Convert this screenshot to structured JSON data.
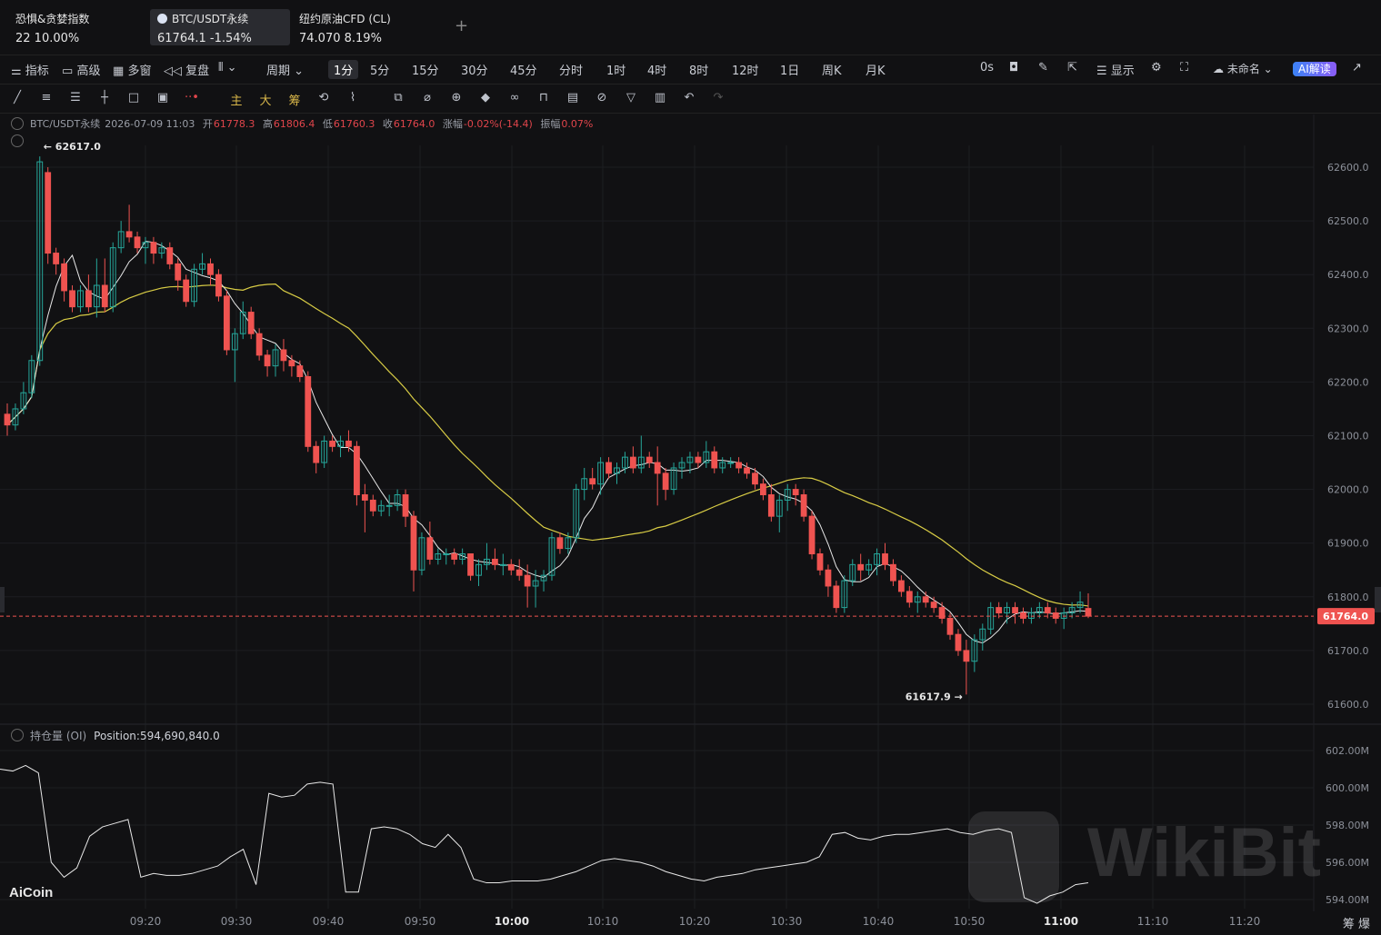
{
  "tickers": [
    {
      "name": "恐惧&贪婪指数",
      "value": "22  10.00%"
    },
    {
      "name": "BTC/USDT永续",
      "value": "61764.1  -1.54%"
    },
    {
      "name": "纽约原油CFD (CL)",
      "value": "74.070  8.19%"
    }
  ],
  "toolbar": {
    "left": [
      "指标",
      "高级",
      "多窗",
      "复盘"
    ],
    "period_label": "周期",
    "periods": [
      "1分",
      "5分",
      "15分",
      "30分",
      "45分",
      "分时",
      "1时",
      "4时",
      "8时",
      "12时",
      "1日",
      "周K",
      "月K"
    ],
    "active_period": "1分",
    "countdown": "0s",
    "display_label": "显示",
    "layout_name": "未命名",
    "ai_label": "AI解读"
  },
  "draw_tools_colored": [
    "主",
    "大",
    "筹"
  ],
  "info_line": {
    "symbol": "BTC/USDT永续",
    "datetime": "2026-07-09 11:03",
    "open_label": "开",
    "open": "61778.3",
    "high_label": "高",
    "high": "61806.4",
    "low_label": "低",
    "low": "61760.3",
    "close_label": "收",
    "close": "61764.0",
    "chg_label": "涨幅",
    "chg": "-0.02%(-14.4)",
    "amp_label": "振幅",
    "amp": "0.07%"
  },
  "oi_line": {
    "label": "持仓量 (OI)",
    "value": "Position:594,690,840.0"
  },
  "watermark": "WikiBit",
  "brand": "AiCoin",
  "bottom_right": "筹  爆",
  "colors": {
    "up": "#26a69a",
    "down": "#ef5350",
    "ma_fast": "#e8e8e8",
    "ma_slow": "#d8cc45",
    "bg": "#111113"
  },
  "chart_data": {
    "type": "candlestick",
    "last_price": "61764.0",
    "max_label": "62617.0",
    "min_label": "61617.9",
    "y_ticks": [
      "62600.0",
      "62500.0",
      "62400.0",
      "62300.0",
      "62200.0",
      "62100.0",
      "62000.0",
      "61900.0",
      "61800.0",
      "61700.0",
      "61600.0"
    ],
    "oi_ticks": [
      "602.00M",
      "600.00M",
      "598.00M",
      "596.00M",
      "594.00M"
    ],
    "x_ticks": [
      "09:20",
      "09:30",
      "09:40",
      "09:50",
      "10:00",
      "10:10",
      "10:20",
      "10:30",
      "10:40",
      "10:50",
      "11:00",
      "11:10",
      "11:20"
    ],
    "ylim": [
      61560,
      62680
    ],
    "candles": [
      [
        62140,
        62160,
        62100,
        62120
      ],
      [
        62120,
        62160,
        62110,
        62150
      ],
      [
        62150,
        62200,
        62140,
        62180
      ],
      [
        62180,
        62250,
        62170,
        62240
      ],
      [
        62240,
        62620,
        62230,
        62610
      ],
      [
        62590,
        62600,
        62420,
        62440
      ],
      [
        62440,
        62450,
        62400,
        62420
      ],
      [
        62420,
        62430,
        62350,
        62370
      ],
      [
        62370,
        62380,
        62330,
        62340
      ],
      [
        62340,
        62380,
        62330,
        62370
      ],
      [
        62370,
        62400,
        62330,
        62340
      ],
      [
        62340,
        62430,
        62320,
        62380
      ],
      [
        62380,
        62430,
        62330,
        62340
      ],
      [
        62340,
        62460,
        62330,
        62450
      ],
      [
        62450,
        62500,
        62440,
        62480
      ],
      [
        62480,
        62530,
        62460,
        62470
      ],
      [
        62470,
        62480,
        62440,
        62450
      ],
      [
        62450,
        62470,
        62420,
        62460
      ],
      [
        62460,
        62470,
        62420,
        62440
      ],
      [
        62440,
        62460,
        62430,
        62450
      ],
      [
        62450,
        62460,
        62410,
        62420
      ],
      [
        62420,
        62430,
        62370,
        62390
      ],
      [
        62390,
        62400,
        62340,
        62350
      ],
      [
        62350,
        62420,
        62340,
        62410
      ],
      [
        62410,
        62440,
        62400,
        62420
      ],
      [
        62420,
        62430,
        62380,
        62400
      ],
      [
        62400,
        62410,
        62350,
        62360
      ],
      [
        62360,
        62370,
        62250,
        62260
      ],
      [
        62260,
        62300,
        62200,
        62290
      ],
      [
        62290,
        62350,
        62280,
        62330
      ],
      [
        62330,
        62340,
        62280,
        62290
      ],
      [
        62290,
        62300,
        62240,
        62250
      ],
      [
        62250,
        62260,
        62210,
        62230
      ],
      [
        62230,
        62270,
        62210,
        62260
      ],
      [
        62260,
        62280,
        62220,
        62240
      ],
      [
        62240,
        62250,
        62210,
        62230
      ],
      [
        62230,
        62240,
        62200,
        62210
      ],
      [
        62210,
        62220,
        62070,
        62080
      ],
      [
        62080,
        62090,
        62030,
        62050
      ],
      [
        62050,
        62100,
        62040,
        62090
      ],
      [
        62090,
        62100,
        62070,
        62080
      ],
      [
        62080,
        62100,
        62060,
        62090
      ],
      [
        62090,
        62110,
        62070,
        62080
      ],
      [
        62080,
        62090,
        61970,
        61990
      ],
      [
        61990,
        62010,
        61920,
        61980
      ],
      [
        61980,
        61990,
        61950,
        61960
      ],
      [
        61960,
        61980,
        61950,
        61970
      ],
      [
        61970,
        61990,
        61950,
        61970
      ],
      [
        61970,
        62000,
        61960,
        61990
      ],
      [
        61990,
        62000,
        61930,
        61950
      ],
      [
        61950,
        61960,
        61810,
        61850
      ],
      [
        61850,
        61920,
        61840,
        61910
      ],
      [
        61910,
        61940,
        61860,
        61870
      ],
      [
        61870,
        61890,
        61860,
        61880
      ],
      [
        61880,
        61890,
        61860,
        61880
      ],
      [
        61880,
        61890,
        61860,
        61870
      ],
      [
        61870,
        61890,
        61860,
        61880
      ],
      [
        61880,
        61880,
        61830,
        61840
      ],
      [
        61840,
        61870,
        61820,
        61860
      ],
      [
        61860,
        61900,
        61850,
        61870
      ],
      [
        61870,
        61890,
        61850,
        61860
      ],
      [
        61860,
        61880,
        61840,
        61860
      ],
      [
        61860,
        61870,
        61840,
        61850
      ],
      [
        61850,
        61870,
        61830,
        61840
      ],
      [
        61840,
        61860,
        61780,
        61820
      ],
      [
        61820,
        61850,
        61780,
        61830
      ],
      [
        61830,
        61850,
        61810,
        61840
      ],
      [
        61840,
        61920,
        61830,
        61910
      ],
      [
        61910,
        61920,
        61880,
        61890
      ],
      [
        61890,
        61920,
        61880,
        61910
      ],
      [
        61910,
        62010,
        61900,
        62000
      ],
      [
        62000,
        62040,
        61980,
        62020
      ],
      [
        62020,
        62040,
        62000,
        62010
      ],
      [
        62010,
        62060,
        61990,
        62050
      ],
      [
        62050,
        62060,
        62020,
        62030
      ],
      [
        62030,
        62050,
        62010,
        62040
      ],
      [
        62040,
        62070,
        62030,
        62060
      ],
      [
        62060,
        62080,
        62030,
        62040
      ],
      [
        62040,
        62100,
        62030,
        62060
      ],
      [
        62060,
        62070,
        62040,
        62050
      ],
      [
        62050,
        62080,
        61970,
        62030
      ],
      [
        62030,
        62040,
        61980,
        62000
      ],
      [
        62000,
        62050,
        61990,
        62040
      ],
      [
        62040,
        62060,
        62020,
        62050
      ],
      [
        62050,
        62070,
        62030,
        62060
      ],
      [
        62060,
        62070,
        62040,
        62050
      ],
      [
        62050,
        62090,
        62040,
        62070
      ],
      [
        62070,
        62080,
        62030,
        62040
      ],
      [
        62040,
        62060,
        62030,
        62050
      ],
      [
        62050,
        62060,
        62040,
        62050
      ],
      [
        62050,
        62060,
        62030,
        62040
      ],
      [
        62040,
        62050,
        62020,
        62030
      ],
      [
        62030,
        62040,
        62000,
        62010
      ],
      [
        62010,
        62020,
        61980,
        61990
      ],
      [
        61990,
        62010,
        61940,
        61950
      ],
      [
        61950,
        61990,
        61920,
        61980
      ],
      [
        61980,
        62010,
        61960,
        62000
      ],
      [
        62000,
        62010,
        61970,
        61990
      ],
      [
        61990,
        62000,
        61940,
        61950
      ],
      [
        61950,
        61960,
        61870,
        61880
      ],
      [
        61880,
        61890,
        61840,
        61850
      ],
      [
        61850,
        61860,
        61800,
        61820
      ],
      [
        61820,
        61830,
        61770,
        61780
      ],
      [
        61780,
        61840,
        61770,
        61830
      ],
      [
        61830,
        61870,
        61820,
        61860
      ],
      [
        61860,
        61880,
        61830,
        61850
      ],
      [
        61850,
        61870,
        61840,
        61860
      ],
      [
        61860,
        61890,
        61840,
        61880
      ],
      [
        61880,
        61900,
        61850,
        61860
      ],
      [
        61860,
        61870,
        61820,
        61830
      ],
      [
        61830,
        61840,
        61800,
        61810
      ],
      [
        61810,
        61820,
        61780,
        61790
      ],
      [
        61790,
        61810,
        61770,
        61800
      ],
      [
        61800,
        61810,
        61780,
        61790
      ],
      [
        61790,
        61800,
        61770,
        61780
      ],
      [
        61780,
        61790,
        61750,
        61760
      ],
      [
        61760,
        61770,
        61720,
        61730
      ],
      [
        61730,
        61740,
        61690,
        61700
      ],
      [
        61700,
        61720,
        61618,
        61680
      ],
      [
        61680,
        61730,
        61660,
        61720
      ],
      [
        61720,
        61750,
        61700,
        61740
      ],
      [
        61740,
        61790,
        61730,
        61780
      ],
      [
        61780,
        61790,
        61760,
        61770
      ],
      [
        61770,
        61790,
        61750,
        61780
      ],
      [
        61780,
        61790,
        61750,
        61770
      ],
      [
        61770,
        61780,
        61750,
        61760
      ],
      [
        61760,
        61780,
        61750,
        61770
      ],
      [
        61770,
        61790,
        61760,
        61780
      ],
      [
        61780,
        61790,
        61760,
        61770
      ],
      [
        61770,
        61780,
        61750,
        61760
      ],
      [
        61760,
        61780,
        61740,
        61770
      ],
      [
        61770,
        61790,
        61760,
        61780
      ],
      [
        61780,
        61810,
        61770,
        61790
      ],
      [
        61778.3,
        61806.4,
        61760.3,
        61764.0
      ]
    ],
    "oi": [
      601,
      600.9,
      601.2,
      600.8,
      596,
      595.2,
      595.7,
      597.4,
      597.9,
      598.1,
      598.3,
      595.2,
      595.4,
      595.3,
      595.3,
      595.4,
      595.6,
      595.8,
      596.3,
      596.7,
      594.8,
      599.7,
      599.5,
      599.6,
      600.2,
      600.3,
      600.2,
      594.4,
      594.4,
      597.8,
      597.9,
      597.8,
      597.5,
      597,
      596.8,
      597.5,
      596.8,
      595.1,
      594.9,
      594.9,
      595,
      595,
      595,
      595.1,
      595.3,
      595.5,
      595.8,
      596.1,
      596.2,
      596.1,
      596,
      595.8,
      595.5,
      595.3,
      595.1,
      595,
      595.2,
      595.3,
      595.4,
      595.6,
      595.7,
      595.8,
      595.9,
      596,
      596.3,
      597.5,
      597.6,
      597.3,
      597.2,
      597.4,
      597.5,
      597.5,
      597.6,
      597.7,
      597.8,
      597.6,
      597.5,
      597.7,
      597.8,
      597.6,
      594.1,
      593.8,
      594.2,
      594.4,
      594.8,
      594.9
    ]
  }
}
